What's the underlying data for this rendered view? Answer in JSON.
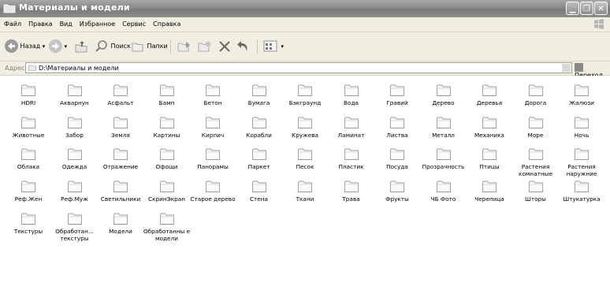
{
  "window": {
    "title": "Материалы и модели"
  },
  "menu": [
    "Файл",
    "Правка",
    "Вид",
    "Избранное",
    "Сервис",
    "Справка"
  ],
  "toolbar": {
    "back": "Назад",
    "search": "Поиск",
    "folders": "Папки"
  },
  "address": {
    "label": "Адрес:",
    "path": "D:\\Материалы и модели",
    "go": "Переход"
  },
  "items": [
    [
      "HDRI",
      "Акварнун",
      "Асфальт",
      "Бамп",
      "Бетон",
      "Бумага",
      "Бэкграунд",
      "Вода",
      "Гравий",
      "Дерево",
      "Деревья",
      "Дорога",
      "Жалюзи"
    ],
    [
      "Животные",
      "Забор",
      "Земля",
      "Картины",
      "Кирпич",
      "Корабли",
      "Кружева",
      "Ламинат",
      "Листва",
      "Металл",
      "Механика",
      "Море",
      "Ночь"
    ],
    [
      "Облака",
      "Одежда",
      "Отражение",
      "Офощи",
      "Панорамы",
      "Паркет",
      "Песок",
      "Пластик",
      "Посуда",
      "Прозрачность",
      "Птицы",
      "Растения комнатные",
      "Растения наружние"
    ],
    [
      "Реф.Жен",
      "Реф.Муж",
      "Светильники",
      "СкринЭкран",
      "Старое дерево",
      "Стена",
      "Ткани",
      "Трава",
      "Фрукты",
      "ЧБ Фото",
      "Черепица",
      "Шторы",
      "Штукатурка"
    ],
    [
      "Текстуры",
      "Обработан... текстуры",
      "Модели",
      "Обработанны е модели"
    ]
  ]
}
